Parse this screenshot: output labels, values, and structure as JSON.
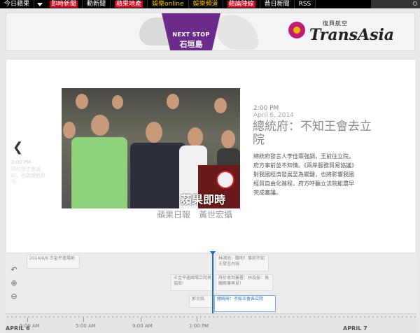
{
  "topnav": {
    "items": [
      "今日蘋果",
      "即時新聞",
      "動新聞",
      "蘋果地產",
      "娛樂online",
      "娛樂頻道",
      "蘋論陣線",
      "昔日新聞",
      "RSS"
    ]
  },
  "banner": {
    "stop_label": "NEXT STOP",
    "stop_city": "石垣島",
    "brand_cn": "復興航空",
    "brand_en": "TransAsia"
  },
  "prev": {
    "time": "2:00 PM",
    "text": "四的學生會議的，別為總統府今..."
  },
  "photo": {
    "watermark": "蘋果即時",
    "caption": "蘋果日報　黃世宏攝"
  },
  "article": {
    "time": "2:00 PM",
    "date": "April 6, 2014",
    "title": "總統府：不知王會去立院",
    "body": "總統府發言人李佳霏強調，王前往立院，府方事前並不知情。《兩岸服務貿易協議》對我國經濟發展至為關鍵，也將影響我國經貿自由化進程，府方呼籲立法院能盡早完成審議。"
  },
  "timeline": {
    "cards": [
      {
        "text": "2014/4/6 王金平進場地"
      },
      {
        "text": "林鴻池：聽明！事前不知王發言內容"
      },
      {
        "text": "王金平進國場立院再協商！"
      },
      {
        "text": "許於收到簽署：林為偷：角顏兩兼再見！"
      },
      {
        "text": "郭台銘"
      },
      {
        "text": "總統府：不知王會去立院"
      }
    ],
    "ticks": [
      "5:00 AM",
      "5:00 AM",
      "9:00 AM",
      "1:00 PM"
    ],
    "day_start": "APRIL 6",
    "day_end": "APRIL 7"
  },
  "icons": {
    "back": "undo-arrow-icon",
    "zoom_in": "zoom-in-icon",
    "zoom_out": "zoom-out-icon"
  }
}
